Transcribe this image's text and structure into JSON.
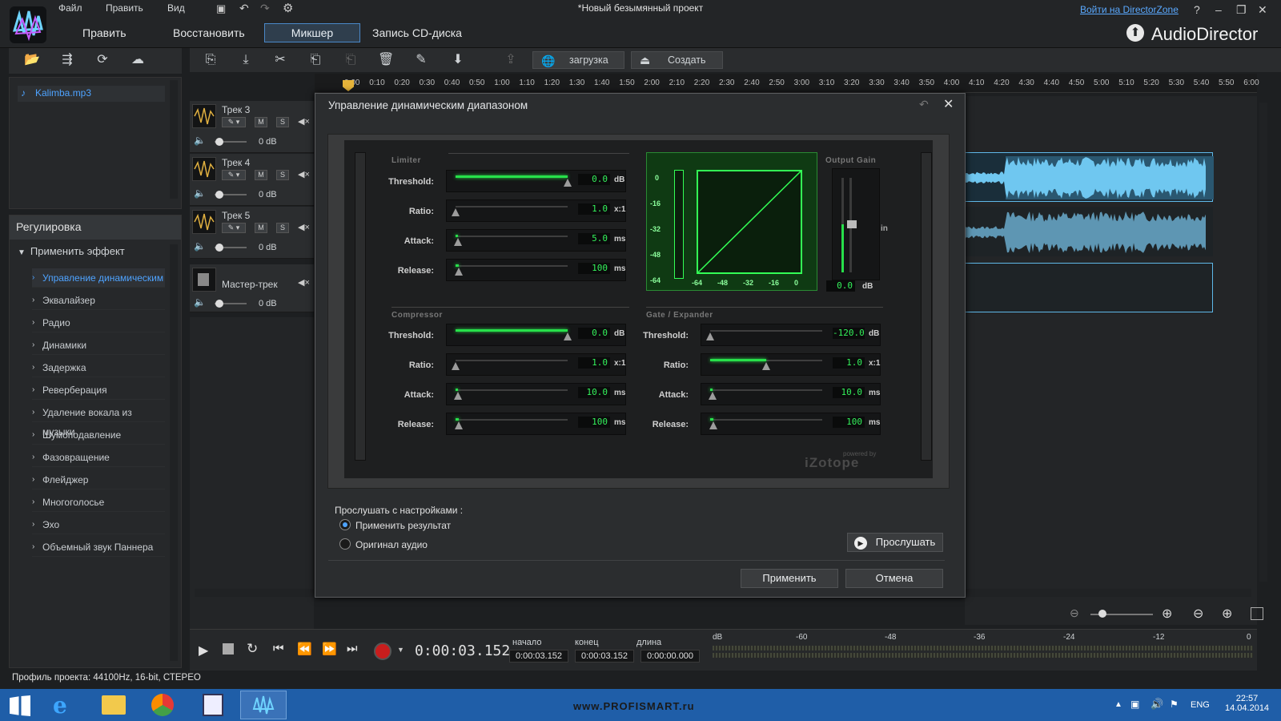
{
  "app": {
    "brand": "AudioDirector",
    "title": "*Новый безымянный проект",
    "login_link": "Войти на DirectorZone"
  },
  "menu": [
    "Файл",
    "Править",
    "Вид"
  ],
  "nav": {
    "edit": "Править",
    "restore": "Восстановить",
    "mixer": "Микшер",
    "cd": "Запись CD-диска"
  },
  "toolbar": {
    "load": "загрузка",
    "create": "Создать"
  },
  "ruler": [
    "0:00",
    "0:10",
    "0:20",
    "0:30",
    "0:40",
    "0:50",
    "1:00",
    "1:10",
    "1:20",
    "1:30",
    "1:40",
    "1:50",
    "2:00",
    "2:10",
    "2:20",
    "2:30",
    "2:40",
    "2:50",
    "3:00",
    "3:10",
    "3:20",
    "3:30",
    "3:40",
    "3:50",
    "4:00",
    "4:10",
    "4:20",
    "4:30",
    "4:40",
    "4:50",
    "5:00",
    "5:10",
    "5:20",
    "5:30",
    "5:40",
    "5:50",
    "6:00"
  ],
  "library": {
    "file": "Kalimba.mp3"
  },
  "adjust": {
    "title": "Регулировка",
    "apply_effect": "Применить эффект",
    "effects": [
      "Управление динамическим",
      "Эквалайзер",
      "Радио",
      "Динамики",
      "Задержка",
      "Реверберация",
      "Удаление вокала из музыки",
      "Шумоподавление",
      "Фазовращение",
      "Флейджер",
      "Многоголосье",
      "Эхо",
      "Объемный звук Паннера"
    ]
  },
  "tracks": [
    {
      "name": "Трек 3",
      "db": "0 dB"
    },
    {
      "name": "Трек 4",
      "db": "0 dB"
    },
    {
      "name": "Трек 5",
      "db": "0 dB"
    },
    {
      "name": "Мастер-трек",
      "db": "0 dB"
    }
  ],
  "track_buttons": {
    "m": "M",
    "s": "S"
  },
  "transport": {
    "time": "0:00:03.152",
    "start_label": "начало",
    "end_label": "конец",
    "len_label": "длина",
    "start": "0:00:03.152",
    "end": "0:00:03.152",
    "len": "0:00:00.000"
  },
  "meter_labels": [
    "dB",
    "-60",
    "-48",
    "-36",
    "-24",
    "-12",
    "0"
  ],
  "profile": "Профиль проекта: 44100Hz, 16-bit, СТЕРЕО",
  "taskbar": {
    "lang": "ENG",
    "time": "22:57",
    "date": "14.04.2014",
    "watermark": "www.PROFISMART.ru"
  },
  "dialog": {
    "title": "Управление динамическим диапазоном",
    "limiter": {
      "title": "Limiter",
      "params": [
        {
          "label": "Threshold:",
          "value": "0.0",
          "unit": "dB",
          "level": 1.0
        },
        {
          "label": "Ratio:",
          "value": "1.0",
          "unit": "x:1",
          "level": 0.0
        },
        {
          "label": "Attack:",
          "value": "5.0",
          "unit": "ms",
          "level": 0.02
        },
        {
          "label": "Release:",
          "value": "100",
          "unit": "ms",
          "level": 0.03
        }
      ]
    },
    "compressor": {
      "title": "Compressor",
      "params": [
        {
          "label": "Threshold:",
          "value": "0.0",
          "unit": "dB",
          "level": 1.0
        },
        {
          "label": "Ratio:",
          "value": "1.0",
          "unit": "x:1",
          "level": 0.0
        },
        {
          "label": "Attack:",
          "value": "10.0",
          "unit": "ms",
          "level": 0.02
        },
        {
          "label": "Release:",
          "value": "100",
          "unit": "ms",
          "level": 0.03
        }
      ]
    },
    "gate": {
      "title": "Gate / Expander",
      "params": [
        {
          "label": "Threshold:",
          "value": "-120.0",
          "unit": "dB",
          "level": 0.0
        },
        {
          "label": "Ratio:",
          "value": "1.0",
          "unit": "x:1",
          "level": 0.5
        },
        {
          "label": "Attack:",
          "value": "10.0",
          "unit": "ms",
          "level": 0.02
        },
        {
          "label": "Release:",
          "value": "100",
          "unit": "ms",
          "level": 0.03
        }
      ]
    },
    "output_gain": {
      "title": "Output Gain",
      "value": "0.0",
      "unit": "dB",
      "side_label": "in"
    },
    "graph_y": [
      "0",
      "-16",
      "-32",
      "-48",
      "-64"
    ],
    "graph_x": [
      "-64",
      "-48",
      "-32",
      "-16",
      "0"
    ],
    "brand": "iZotope",
    "brand_small": "powered by",
    "listen_label": "Прослушать с настройками :",
    "radio_apply": "Применить результат",
    "radio_orig": "Оригинал аудио",
    "listen_btn": "Прослушать",
    "apply_btn": "Применить",
    "cancel_btn": "Отмена"
  },
  "colors": {
    "accent": "#4ea3ff",
    "led": "#27e04a",
    "wave": "#6fc7f0"
  }
}
